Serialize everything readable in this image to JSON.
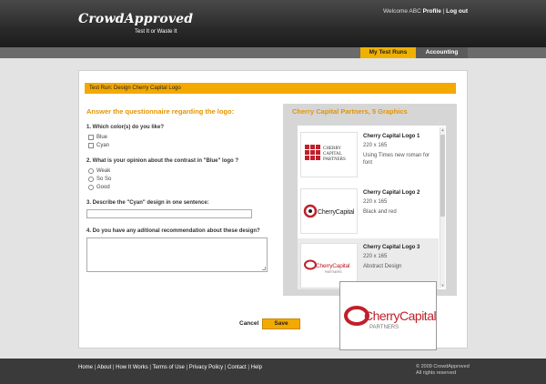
{
  "header": {
    "logo": "CrowdApproved",
    "tagline": "Test It or Waste It",
    "welcome": "Welcome ABC",
    "profile": "Profile",
    "separator": "|",
    "logout": "Log out"
  },
  "tabs": {
    "my_test_runs": "My Test Runs",
    "accounting": "Accounting"
  },
  "test_run_title": "Test Run: Design Cherry Capital Logo",
  "questionnaire": {
    "heading": "Answer the questionnaire regarding the logo:",
    "q1": {
      "label": "1. Which color(s) do you like?",
      "options": [
        "Blue",
        "Cyan"
      ]
    },
    "q2": {
      "label": "2. What is your opinion about the contrast in \"Blue\" logo ?",
      "options": [
        "Weak",
        "So So",
        "Good"
      ]
    },
    "q3": {
      "label": "3. Describe the \"Cyan\" design in one sentence:",
      "value": ""
    },
    "q4": {
      "label": "4. Do you have any aditional recommendation about these design?",
      "value": ""
    }
  },
  "graphics": {
    "heading": "Cherry Capital Partners, 5 Graphics",
    "items": [
      {
        "name": "Cherry Capital Logo 1",
        "size": "220 x 165",
        "desc": "Using Times new roman for font",
        "logo_text": "CHERRY CAPITAL PARTNERS"
      },
      {
        "name": "Cherry Capital Logo 2",
        "size": "220 x 165",
        "desc": "Black and red",
        "logo_text": "CherryCapital"
      },
      {
        "name": "Cherry Capital Logo 3",
        "size": "220 x 165",
        "desc": "Abstract Design",
        "logo_text": "CherryCapital",
        "logo_sub": "PARTNERS"
      }
    ]
  },
  "preview": {
    "logo_text": "CherryCapital",
    "logo_sub": "PARTNERS"
  },
  "actions": {
    "cancel": "Cancel",
    "save": "Save"
  },
  "footer": {
    "links": [
      "Home",
      "About",
      "How It Works",
      "Terms of Use",
      "Privacy Policy",
      "Contact",
      "Help"
    ],
    "copyright": "© 2009 CrowdApproved",
    "rights": "All rights reserved"
  },
  "colors": {
    "accent": "#f3a900",
    "header": "#2a2a2a",
    "brand_red": "#c0202a"
  }
}
